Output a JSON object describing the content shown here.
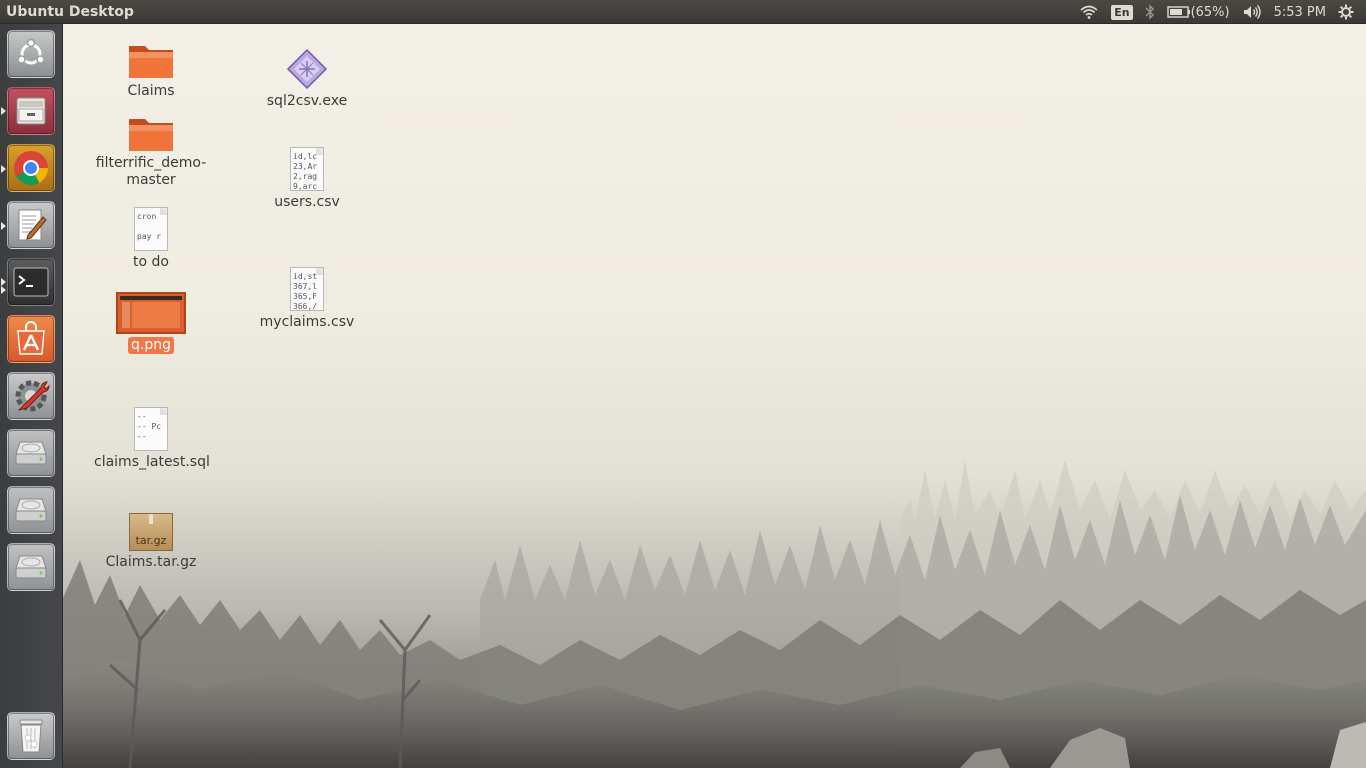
{
  "panel": {
    "title": "Ubuntu Desktop",
    "keyboard_layout": "En",
    "battery": "(65%)",
    "clock": "5:53 PM",
    "icons": [
      "wifi-icon",
      "keyboard-layout-indicator",
      "bluetooth-icon",
      "battery-icon",
      "volume-icon",
      "gear-icon"
    ]
  },
  "launcher": {
    "items": [
      {
        "name": "dash-home",
        "icon": "ubuntu-logo-icon"
      },
      {
        "name": "files",
        "icon": "file-cabinet-icon"
      },
      {
        "name": "chrome",
        "icon": "chrome-icon"
      },
      {
        "name": "text-editor",
        "icon": "text-editor-icon"
      },
      {
        "name": "terminal",
        "icon": "terminal-icon"
      },
      {
        "name": "software-center",
        "icon": "software-center-icon"
      },
      {
        "name": "system-settings",
        "icon": "settings-wrench-icon"
      },
      {
        "name": "drive-1",
        "icon": "hard-drive-icon"
      },
      {
        "name": "drive-2",
        "icon": "hard-drive-icon"
      },
      {
        "name": "drive-3",
        "icon": "hard-drive-icon"
      },
      {
        "name": "trash",
        "icon": "trash-icon"
      }
    ]
  },
  "desktop": {
    "icons": [
      {
        "label": "Claims",
        "type": "folder"
      },
      {
        "label": "filterrific_demo-\nmaster",
        "type": "folder"
      },
      {
        "label": "to do",
        "type": "text",
        "preview": [
          "cron",
          "",
          "pay r"
        ]
      },
      {
        "label": "q.png",
        "type": "image",
        "selected": true
      },
      {
        "label": "claims_latest.sql",
        "type": "text",
        "preview": [
          "--",
          "-- Pc",
          "--"
        ]
      },
      {
        "label": "Claims.tar.gz",
        "type": "archive",
        "badge": "tar.gz"
      },
      {
        "label": "sql2csv.exe",
        "type": "executable"
      },
      {
        "label": "users.csv",
        "type": "text",
        "preview": [
          "id,lc",
          "23,Ar",
          "2,rag",
          "9,arc"
        ]
      },
      {
        "label": "myclaims.csv",
        "type": "text",
        "preview": [
          "id,st",
          "367,l",
          "365,F",
          "366,/"
        ]
      }
    ]
  }
}
